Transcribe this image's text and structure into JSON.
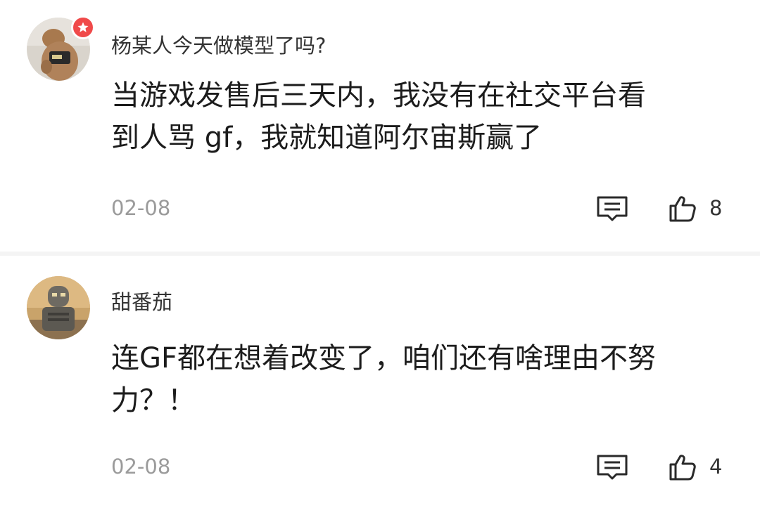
{
  "comments": [
    {
      "username": "杨某人今天做模型了吗?",
      "content_lines": [
        "当游戏发售后三天内，我没有在社交平台看",
        "到人骂 gf，我就知道阿尔宙斯赢了"
      ],
      "date": "02-08",
      "likes": "8",
      "avatar_icon": "toy-figure-avatar",
      "badge_icon": "star-badge-icon"
    },
    {
      "username": "甜番茄",
      "content_lines": [
        "连GF都在想着改变了，咱们还有啥理由不努",
        "力？！"
      ],
      "date": "02-08",
      "likes": "4",
      "avatar_icon": "robot-avatar"
    }
  ],
  "icons": {
    "reply": "comment-icon",
    "like": "thumbs-up-icon"
  },
  "colors": {
    "badge": "#f04a4a",
    "date_text": "#9b9b9b",
    "divider": "#f4f4f4"
  }
}
